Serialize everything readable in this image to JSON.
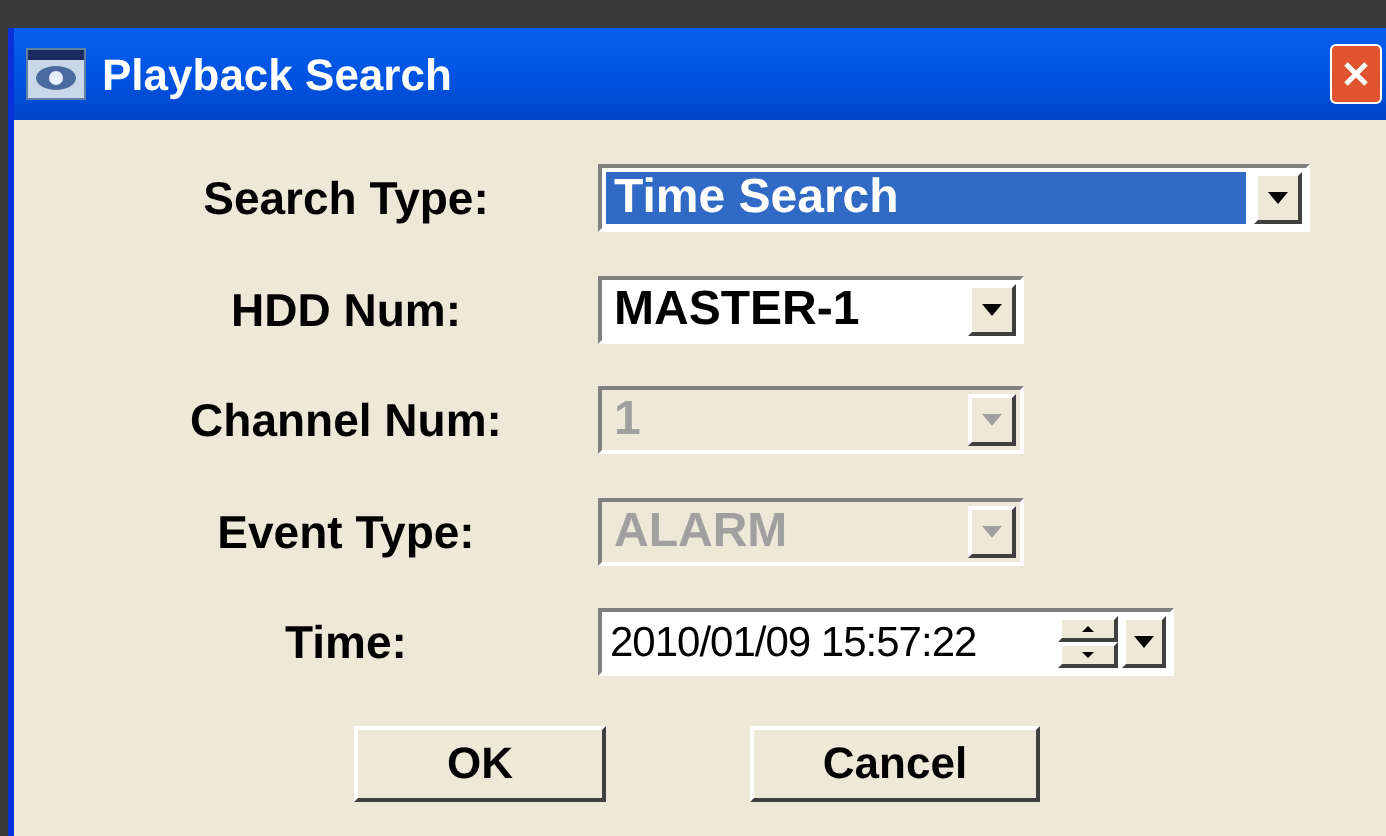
{
  "window": {
    "title": "Playback Search"
  },
  "fields": [
    {
      "kind": "combo",
      "label": "Search Type:",
      "value": "Time Search",
      "disabled": false,
      "focused": true
    },
    {
      "kind": "combo",
      "label": "HDD Num:",
      "value": "MASTER-1",
      "disabled": false
    },
    {
      "kind": "combo",
      "label": "Channel Num:",
      "value": "1",
      "disabled": true
    },
    {
      "kind": "combo",
      "label": "Event Type:",
      "value": "ALARM",
      "disabled": true
    },
    {
      "kind": "datetime",
      "label": "Time:",
      "value": "2010/01/09 15:57:22",
      "disabled": false
    }
  ],
  "buttons": [
    "OK",
    "Cancel"
  ]
}
